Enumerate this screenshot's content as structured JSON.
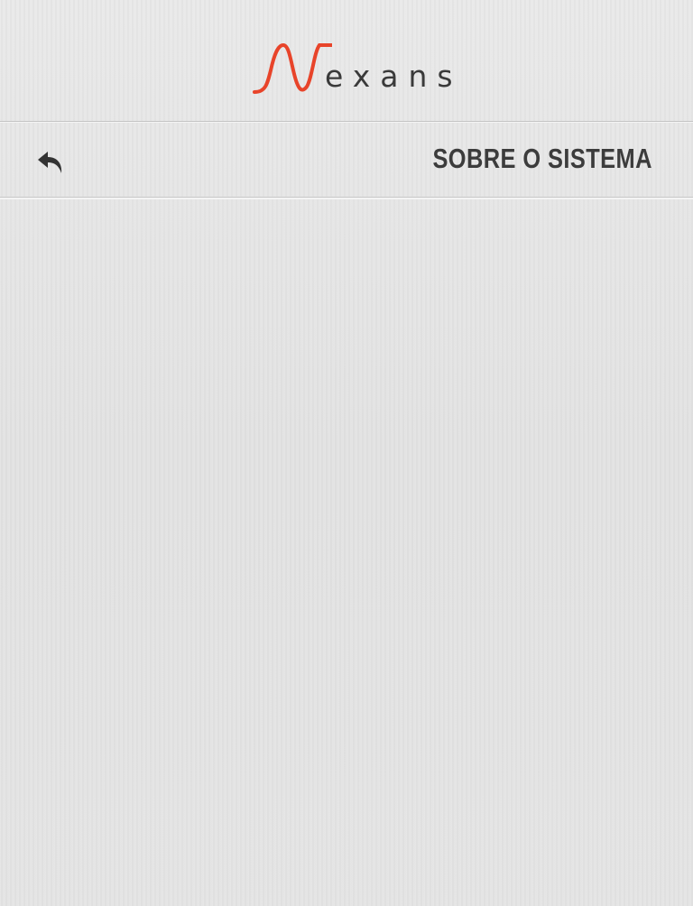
{
  "header": {
    "logo_text": "Nexans",
    "logo_word": "exans",
    "logo_color": "#e8442a"
  },
  "title_bar": {
    "title": "SOBRE O SISTEMA",
    "back_icon": "reply-arrow-icon"
  }
}
